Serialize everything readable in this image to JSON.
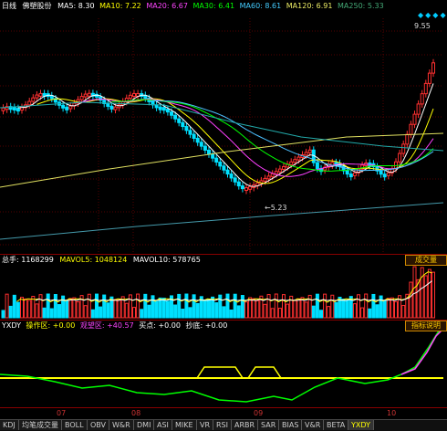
{
  "price_header": {
    "period": "日线",
    "name": "佛塑股份",
    "ma5": "MA5: 8.30",
    "ma10": "MA10: 7.22",
    "ma20": "MA20: 6.67",
    "ma30": "MA30: 6.41",
    "ma60": "MA60: 8.61",
    "ma120": "MA120: 6.91",
    "ma250": "MA250: 5.33"
  },
  "price_panel": {
    "high_label": "9.55",
    "low_label": "5.23"
  },
  "volume_header": {
    "total": "总手: 1168299",
    "mavol5": "MAVOL5: 1048124",
    "mavol10": "MAVOL10: 578765",
    "button": "成交量"
  },
  "indicator_header": {
    "name": "YXDY",
    "c1": "操作区: +0.00",
    "c2": "观望区: +40.57",
    "c3": "买点: +0.00",
    "c4": "抄底: +0.00",
    "button": "指标说明"
  },
  "x_axis": [
    "07",
    "08",
    "09",
    "10"
  ],
  "tabs": [
    "KDJ",
    "均笔成交量",
    "BOLL",
    "OBV",
    "W&R",
    "DMI",
    "ASI",
    "MIKE",
    "VR",
    "RSI",
    "ARBR",
    "SAR",
    "BIAS",
    "V&R",
    "BETA",
    "YXDY"
  ],
  "active_tab": "YXDY",
  "colors": {
    "up": "#ff3030",
    "down": "#00e0ff",
    "ma5": "#ffffff",
    "ma10": "#ffff00",
    "ma20": "#ff40ff",
    "ma30": "#00ff00",
    "ma60": "#4cc0ff",
    "ma120": "#e0e060",
    "ma250": "#6fc0ff"
  }
}
